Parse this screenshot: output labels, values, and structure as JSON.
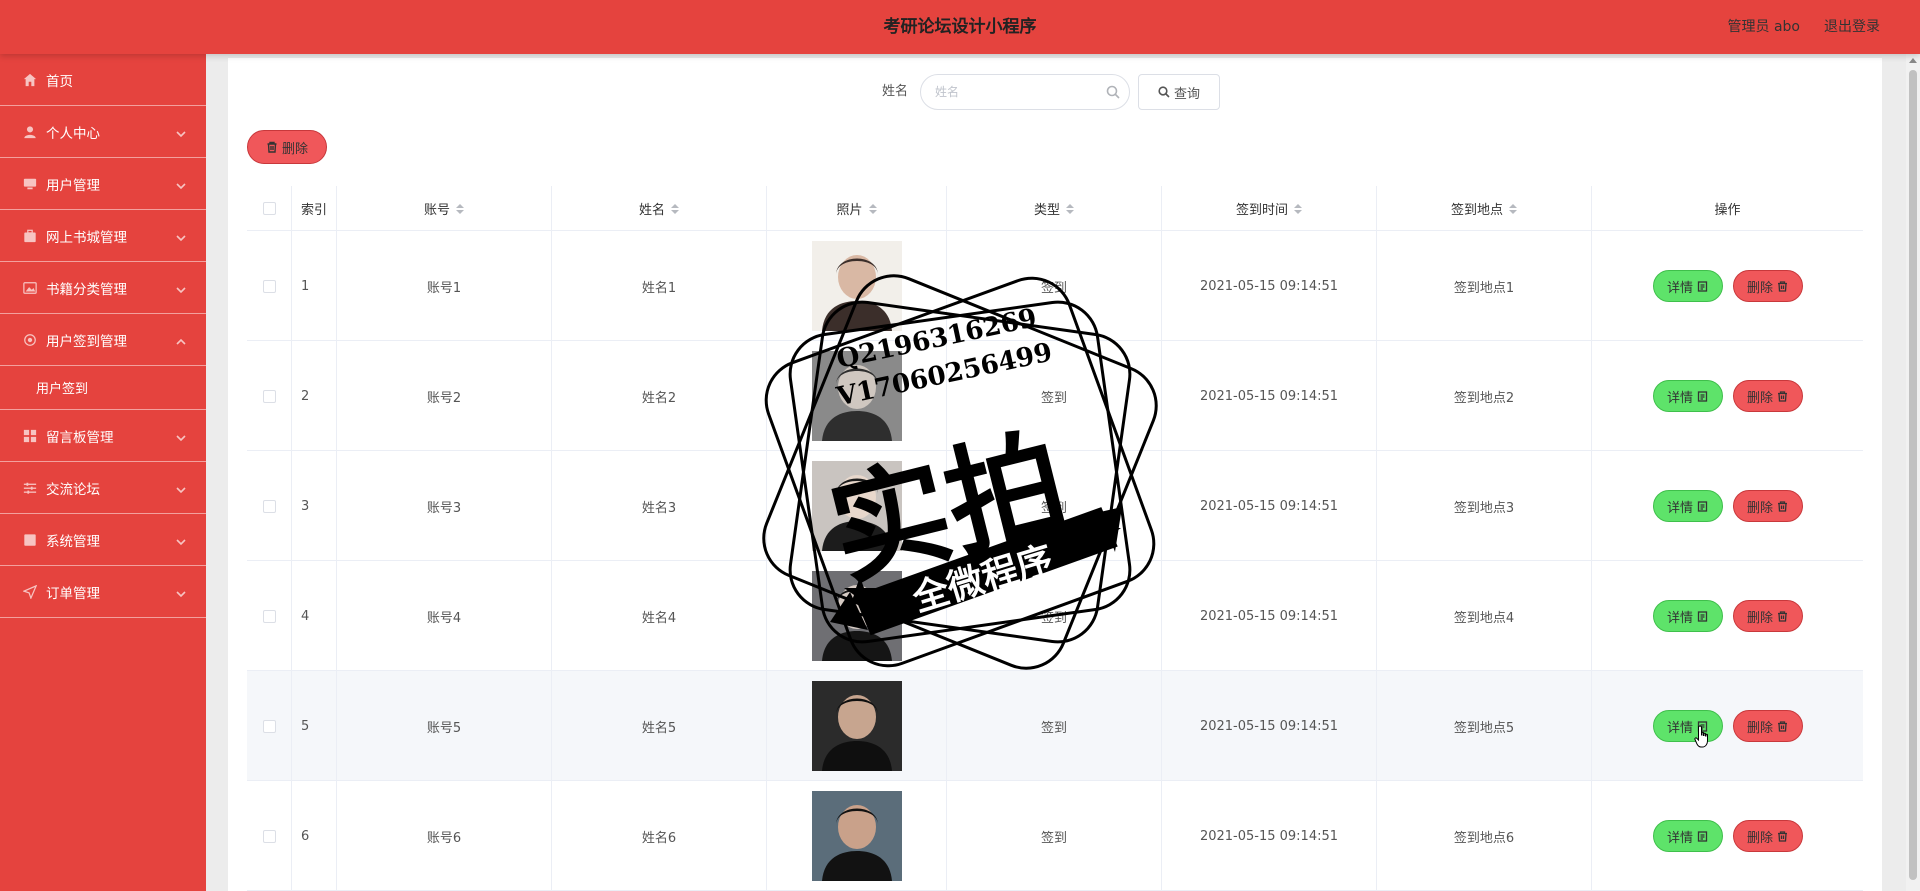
{
  "header": {
    "title": "考研论坛设计小程序",
    "user_label": "管理员 abo",
    "logout_label": "退出登录"
  },
  "sidebar": {
    "items": [
      {
        "label": "首页",
        "icon": "home-icon",
        "expandable": false
      },
      {
        "label": "个人中心",
        "icon": "user-icon",
        "expandable": true
      },
      {
        "label": "用户管理",
        "icon": "monitor-icon",
        "expandable": true
      },
      {
        "label": "网上书城管理",
        "icon": "briefcase-icon",
        "expandable": true
      },
      {
        "label": "书籍分类管理",
        "icon": "image-icon",
        "expandable": true
      },
      {
        "label": "用户签到管理",
        "icon": "settings-icon",
        "expandable": true,
        "expanded": true
      },
      {
        "label": "留言板管理",
        "icon": "grid-icon",
        "expandable": true
      },
      {
        "label": "交流论坛",
        "icon": "sliders-icon",
        "expandable": true
      },
      {
        "label": "系统管理",
        "icon": "checkbox-icon",
        "expandable": true
      },
      {
        "label": "订单管理",
        "icon": "send-icon",
        "expandable": true
      }
    ],
    "sub_item": "用户签到"
  },
  "search": {
    "label": "姓名",
    "placeholder": "姓名",
    "query_label": "查询"
  },
  "toolbar": {
    "delete_label": "删除"
  },
  "table": {
    "columns": [
      "索引",
      "账号",
      "姓名",
      "照片",
      "类型",
      "签到时间",
      "签到地点",
      "操作"
    ],
    "rows": [
      {
        "index": "1",
        "account": "账号1",
        "name": "姓名1",
        "type": "签到",
        "time": "2021-05-15 09:14:51",
        "place": "签到地点1"
      },
      {
        "index": "2",
        "account": "账号2",
        "name": "姓名2",
        "type": "签到",
        "time": "2021-05-15 09:14:51",
        "place": "签到地点2"
      },
      {
        "index": "3",
        "account": "账号3",
        "name": "姓名3",
        "type": "签到",
        "time": "2021-05-15 09:14:51",
        "place": "签到地点3"
      },
      {
        "index": "4",
        "account": "账号4",
        "name": "姓名4",
        "type": "签到",
        "time": "2021-05-15 09:14:51",
        "place": "签到地点4"
      },
      {
        "index": "5",
        "account": "账号5",
        "name": "姓名5",
        "type": "签到",
        "time": "2021-05-15 09:14:51",
        "place": "签到地点5"
      },
      {
        "index": "6",
        "account": "账号6",
        "name": "姓名6",
        "type": "签到",
        "time": "2021-05-15 09:14:51",
        "place": "签到地点6"
      }
    ],
    "detail_label": "详情",
    "delete_label": "删除"
  },
  "watermark": {
    "line1": "Q2196316269",
    "line2": "V17060256499",
    "big": "实拍",
    "ribbon": "全微程序"
  },
  "colors": {
    "brand": "#e5433e",
    "detail_green": "#5ee36a",
    "delete_red": "#f0575a"
  }
}
